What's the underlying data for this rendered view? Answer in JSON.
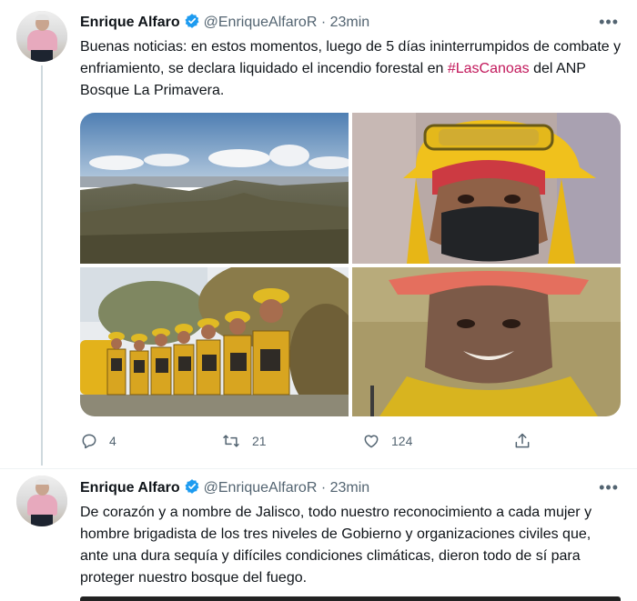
{
  "tweets": [
    {
      "author_name": "Enrique Alfaro",
      "handle": "@EnriqueAlfaroR",
      "separator": "·",
      "time": "23min",
      "text_before": "Buenas noticias: en estos momentos, luego de 5 días ininterrumpidos de combate y enfriamiento, se declara liquidado el incendio forestal en ",
      "hashtag": "#LasCanoas",
      "text_after": " del ANP Bosque La Primavera.",
      "media": [
        "landscape-photo",
        "firefighter-woman-photo",
        "brigade-group-photo",
        "firefighter-man-photo"
      ],
      "actions": {
        "reply_count": "4",
        "retweet_count": "21",
        "like_count": "124"
      }
    },
    {
      "author_name": "Enrique Alfaro",
      "handle": "@EnriqueAlfaroR",
      "separator": "·",
      "time": "23min",
      "text": "De corazón y a nombre de Jalisco, todo nuestro reconocimiento a cada mujer y hombre brigadista de los tres niveles de Gobierno y organizaciones civiles que, ante una dura sequía y difíciles condiciones climáticas, dieron todo de sí para proteger nuestro bosque del fuego."
    }
  ],
  "colors": {
    "hashtag": "#c2185b",
    "verified": "#1d9bf0",
    "muted": "#536471"
  },
  "icons": [
    "verified-badge-icon",
    "more-icon",
    "reply-icon",
    "retweet-icon",
    "like-icon",
    "share-icon"
  ]
}
